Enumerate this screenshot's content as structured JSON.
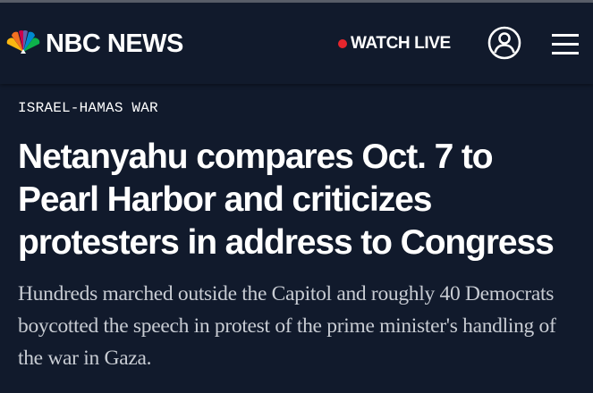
{
  "header": {
    "brand": "NBC NEWS",
    "watch_live_label": "WATCH LIVE",
    "peacock_colors": [
      "#fcb711",
      "#f37021",
      "#cc004c",
      "#6460aa",
      "#0089d0",
      "#0db14b"
    ],
    "live_dot_color": "#e6262d",
    "icons": {
      "logo": "nbc-peacock-icon",
      "live": "live-dot-icon",
      "account": "user-account-icon",
      "menu": "hamburger-menu-icon"
    }
  },
  "article": {
    "eyebrow": "ISRAEL-HAMAS WAR",
    "headline": "Netanyahu compares Oct. 7 to Pearl Harbor and criticizes protesters in address to Congress",
    "dek": "Hundreds marched outside the Capitol and roughly 40 Democrats boycotted the speech in protest of the prime minister's handling of the war in Gaza."
  },
  "theme": {
    "background": "#111a2c",
    "dek_color": "#c8ccd3"
  }
}
